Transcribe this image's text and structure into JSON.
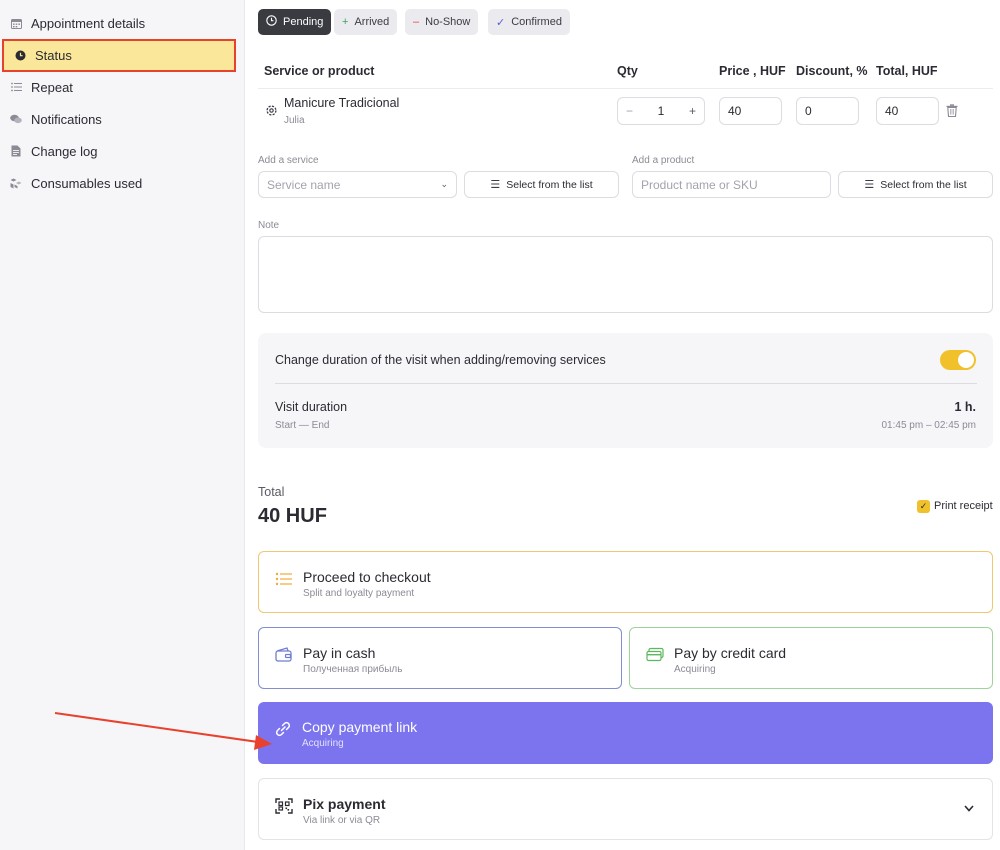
{
  "sidebar": {
    "items": [
      {
        "label": "Appointment details",
        "icon": "calendar-icon"
      },
      {
        "label": "Status",
        "icon": "clock-icon",
        "active": true
      },
      {
        "label": "Repeat",
        "icon": "list-icon"
      },
      {
        "label": "Notifications",
        "icon": "chat-icon"
      },
      {
        "label": "Change log",
        "icon": "document-icon"
      },
      {
        "label": "Consumables used",
        "icon": "boxes-icon"
      }
    ]
  },
  "status_chips": [
    {
      "label": "Pending",
      "icon": "clock-icon",
      "active": true
    },
    {
      "label": "Arrived",
      "icon": "plus-icon",
      "color": "#3aa35b"
    },
    {
      "label": "No-Show",
      "icon": "minus-icon",
      "color": "#e8422e"
    },
    {
      "label": "Confirmed",
      "icon": "check-icon",
      "color": "#5b5bd6"
    }
  ],
  "table": {
    "headers": {
      "service": "Service or product",
      "qty": "Qty",
      "price": "Price , HUF",
      "discount": "Discount, %",
      "total": "Total, HUF"
    },
    "rows": [
      {
        "name": "Manicure Tradicional",
        "staff": "Julia",
        "qty": "1",
        "price": "40",
        "discount": "0",
        "total": "40"
      }
    ]
  },
  "add_service": {
    "label": "Add a service",
    "placeholder": "Service name",
    "list_button": "Select from the list"
  },
  "add_product": {
    "label": "Add a product",
    "placeholder": "Product name or SKU",
    "list_button": "Select from the list"
  },
  "note": {
    "label": "Note",
    "value": ""
  },
  "duration_panel": {
    "toggle_label": "Change duration of the visit when adding/removing services",
    "toggle_on": true,
    "visit_duration_label": "Visit duration",
    "visit_duration_sub": "Start — End",
    "visit_duration_value": "1 h.",
    "visit_duration_time": "01:45 pm – 02:45 pm"
  },
  "total": {
    "label": "Total",
    "value": "40 HUF",
    "print_receipt_label": "Print receipt",
    "print_receipt_checked": true
  },
  "payment_options": {
    "checkout": {
      "title": "Proceed to checkout",
      "subtitle": "Split and loyalty payment",
      "icon": "list-icon",
      "border": "#f0c773"
    },
    "cash": {
      "title": "Pay in cash",
      "subtitle": "Полученная прибыль",
      "icon": "wallet-icon",
      "border": "#7f8fcf"
    },
    "card": {
      "title": "Pay by credit card",
      "subtitle": "Acquiring",
      "icon": "credit-card-icon",
      "border": "#9ed39a"
    },
    "link": {
      "title": "Copy payment link",
      "subtitle": "Acquiring",
      "icon": "link-icon",
      "background": "#7b74ee"
    },
    "pix": {
      "title": "Pix payment",
      "subtitle": "Via link or via QR",
      "icon": "qr-icon"
    }
  },
  "colors": {
    "accent": "#f0c12b",
    "active_highlight": "#fbe79a",
    "annotation_red": "#e8422e",
    "link_button": "#7b74ee"
  }
}
